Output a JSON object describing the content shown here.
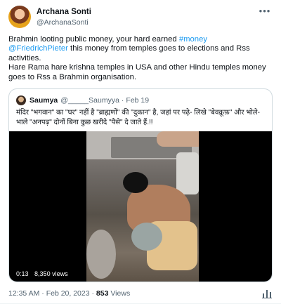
{
  "author": {
    "display_name": "Archana Sonti",
    "handle": "@ArchanaSonti"
  },
  "more_label": "•••",
  "tweet": {
    "text_1": "Brahmin looting public money, your hard earned ",
    "hashtag": "#money",
    "mention": "@FriedrichPieter",
    "text_2": " this money from temples goes to elections and Rss activities.",
    "text_3": "Hare Rama hare krishna temples in USA and other Hindu temples money goes to Rss a Brahmin organisation."
  },
  "quote": {
    "display_name": "Saumya",
    "handle": "@_____Saumyya",
    "separator": "·",
    "date": "Feb 19",
    "text": "मंदिर \"भगवान\" का \"घर\" नहीं है \"ब्राह्मणों\" की \"दुकान\" है, जहां पर पढ़े- लिखे \"बेवक़ूफ़\" और भोले-भाले \"अनपढ़\" दोनों बिना कुछ खरीदे \"पैसे\" दे जाते हैं.!!",
    "video": {
      "duration": "0:13",
      "views": "8,350 views"
    }
  },
  "footer": {
    "timestamp": "12:35 AM · Feb 20, 2023 · ",
    "views_count": "853",
    "views_label": " Views"
  },
  "colors": {
    "link": "#1d9bf0",
    "secondary_text": "#536471",
    "border": "#cfd9de"
  },
  "icons": {
    "more": "more-dots-icon",
    "stats": "bar-chart-icon"
  }
}
